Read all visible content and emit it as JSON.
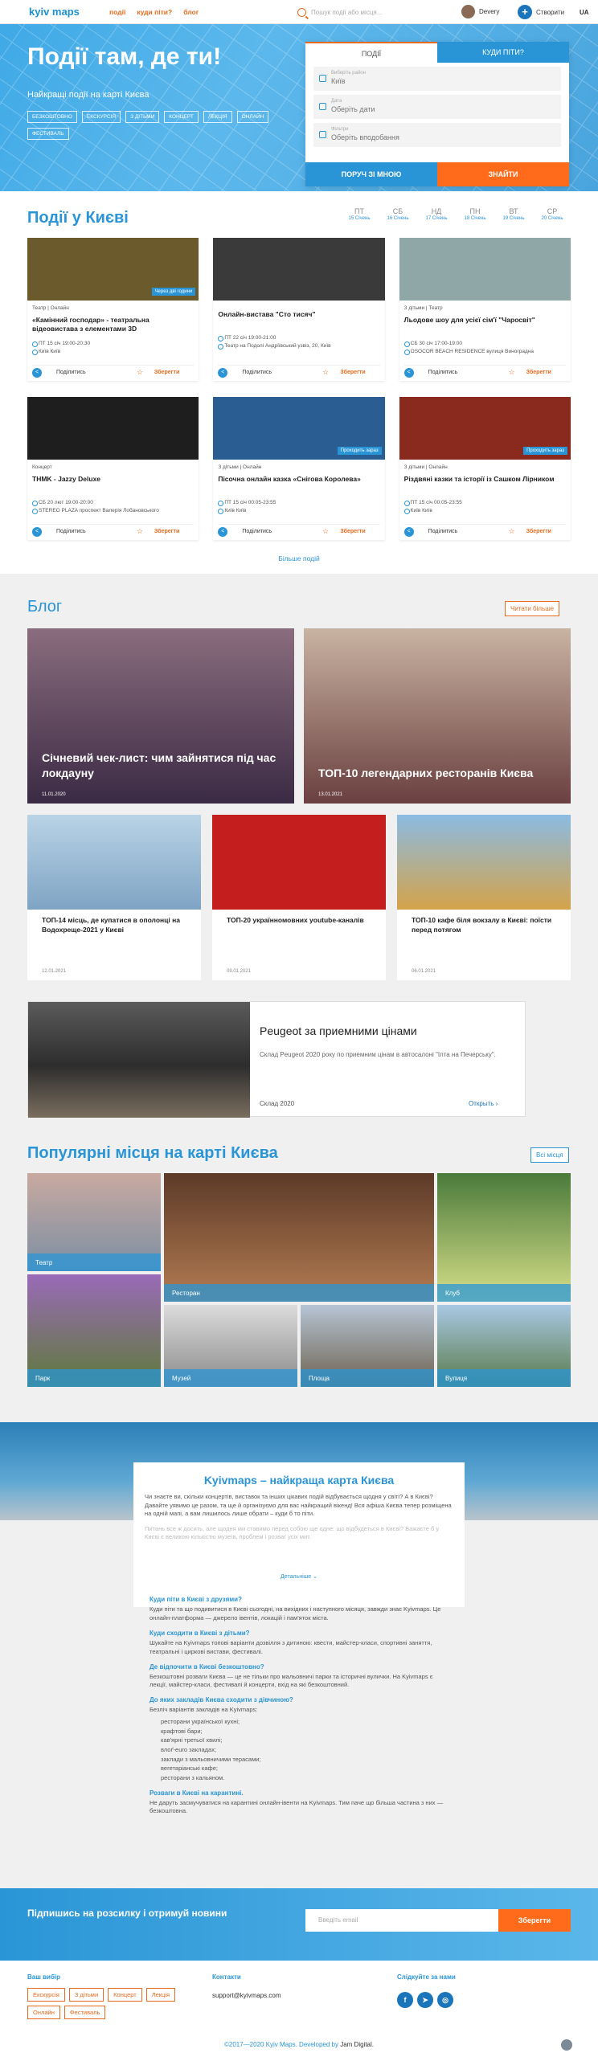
{
  "header": {
    "logo": "kyiv maps",
    "nav": [
      "події",
      "куди піти?",
      "блог"
    ],
    "search_placeholder": "Пошук події або місця...",
    "user_name": "Devery",
    "create_label": "Створити",
    "language": "UA"
  },
  "hero": {
    "title": "Події там, де ти!",
    "subtitle": "Найкращі події на карті Києва",
    "tags": [
      "безкоштовно",
      "екскурсія",
      "з дітьми",
      "концерт",
      "лекція",
      "онлайн",
      "фестиваль"
    ]
  },
  "search_box": {
    "tabs": [
      "ПОДІЇ",
      "КУДИ ПІТИ?"
    ],
    "fields": [
      {
        "label": "Виберіть район",
        "value": "Київ"
      },
      {
        "label": "Дата",
        "value": "Оберіть дати"
      },
      {
        "label": "Фільтри",
        "value": "Оберіть вподобання"
      }
    ],
    "nearby_button": "ПОРУЧ ЗІ МНОЮ",
    "find_button": "ЗНАЙТИ"
  },
  "events": {
    "title": "Події у Києві",
    "days": [
      {
        "name": "ПТ",
        "date": "15 Січень"
      },
      {
        "name": "СБ",
        "date": "16 Січень"
      },
      {
        "name": "НД",
        "date": "17 Січень"
      },
      {
        "name": "ПН",
        "date": "18 Січень"
      },
      {
        "name": "ВТ",
        "date": "19 Січень"
      },
      {
        "name": "СР",
        "date": "20 Січень"
      }
    ],
    "cards": [
      {
        "category": "Театр | Онлайн",
        "title": "«Камінний господар» - театральна відеовистава з елементами 3D",
        "date": "ПТ 15 січ 19:00-20:30",
        "place": "Київ Київ",
        "badge": "Через дві години",
        "color": "#6b5a2c"
      },
      {
        "category": "",
        "title": "Онлайн-вистава \"Сто тисяч\"",
        "date": "ПТ 22 січ 19:00-21:00",
        "place": "Театр на Подолі Андріївський узвіз, 20, Київ",
        "badge": "",
        "color": "#3a3a3a"
      },
      {
        "category": "З дітьми | Театр",
        "title": "Льодове шоу для усієї сім'ї \"Чаросвіт\"",
        "date": "СБ 30 січ 17:00-19:00",
        "place": "OSOCOR BEACH RESIDENCE вулиця Виноградна",
        "badge": "",
        "color": "#8fa7a6"
      },
      {
        "category": "Концерт",
        "title": "THMK - Jazzy Deluxe",
        "date": "СБ 20 лют 19:00-20:00",
        "place": "STEREO PLAZA проспект Валерія Лобановського",
        "badge": "",
        "color": "#1e1e1e"
      },
      {
        "category": "З дітьми | Онлайн",
        "title": "Пісочна онлайн казка «Снігова Королева»",
        "date": "ПТ 15 січ 00:05-23:55",
        "place": "Київ Київ",
        "badge": "Проходить зараз",
        "color": "#2a5e93"
      },
      {
        "category": "З дітьми | Онлайн",
        "title": "Різдвяні казки та історії із Сашком Лірником",
        "date": "ПТ 15 січ 00:05-23:55",
        "place": "Київ Київ",
        "badge": "Проходить зараз",
        "color": "#8a2a1e"
      }
    ],
    "share_label": "Поділитись",
    "save_label": "Зберегти",
    "more_label": "Більше подій"
  },
  "blog": {
    "title": "Блог",
    "read_more": "Читати більше",
    "posts": [
      {
        "title": "Січневий чек-лист: чим зайнятися під час локдауну",
        "date": "11.01.2020",
        "color": "#5c4a63"
      },
      {
        "title": "ТОП-10 легендарних ресторанів Києва",
        "date": "13.01.2021",
        "color": "#7a5a5a"
      },
      {
        "title": "ТОП-14 місць, де купатися в ополонці на Водохреще-2021 у Києві",
        "date": "12.01.2021",
        "color": "#7fa4c4"
      },
      {
        "title": "ТОП-20 українномовних youtube-каналів",
        "date": "09.01.2021",
        "color": "#c41e1e"
      },
      {
        "title": "ТОП-10 кафе біля вокзалу в Києві: поїсти перед потягом",
        "date": "06.01.2021",
        "color": "#6aa0cc"
      }
    ]
  },
  "ad": {
    "title": "Peugeot за приемними цінами",
    "text": "Склад Peugeot 2020 року по приемним цінам в автосалоні \"Ілта на Печерську\".",
    "source": "Склад 2020",
    "open": "Открыть"
  },
  "popular": {
    "title": "Популярні місця на карті Києва",
    "all": "Всі місця",
    "places": [
      "Театр",
      "Ресторан",
      "Клуб",
      "Парк",
      "Музей",
      "Площа",
      "Вулиця"
    ]
  },
  "about": {
    "title": "Kyivmaps – найкраща карта Києва",
    "intro": "Чи знаєте ви, скільки концертів, виставок та інших цікавих подій відбувається щодня у світі? А в Києві? Давайте уявимо це разом, та ще й організуємо для вас найкращий вікенд! Вся афіша Києва тепер розміщена на одній мапі, а вам лишилось лише обрати – куди б то піти.",
    "faded": "Питань все ж досить, але щодня ми ставимо перед собою ще одне: що відбудеться в Києві? Бажаєте б у Києві є великою кількістю музеїв, проблем і розваг усіх мит.",
    "details": "Детальніше",
    "faq": [
      {
        "q": "Куди піти в Києві з друзями?",
        "a": "Куди піти та що подивитися в Києві сьогодні, на вихідних і наступного місяця, завжди знає Kyivmaps. Це онлайн-платформа — джерело івентів, локацій і пам'яток міста."
      },
      {
        "q": "Куди сходити в Києві з дітьми?",
        "a": "Шукайте на Kyivmaps топові варіанти дозвілля з дитиною: квести, майстер-класи, спортивні заняття, театральні і циркові вистави, фестивалі."
      },
      {
        "q": "Де відпочити в Києві безкоштовно?",
        "a": "Безкоштовні розваги Києва — це не тільки про мальовничі парки та історичні вулички. На Kyivmaps є лекції, майстер-класи, фестивалі й концерти, вхід на які безкоштовний."
      },
      {
        "q": "До яких закладів Києва сходити з дівчиною?",
        "a": "Безліч варіантів закладів на Kyivmaps:"
      }
    ],
    "list": [
      "ресторани української кухні;",
      "крафтові бари;",
      "кав'ярні третьої хвилі;",
      "влоґ-euro закладах;",
      "заклади з мальовничими терасами;",
      "вегетаріанські кафе;",
      "ресторани з кальяном."
    ],
    "last_q": "Розваги в Києві на карантині.",
    "last_a": "Не даруть засмучуватися на карантині онлайн-івенти на Kyivmaps. Тим паче що більша частина з них — безкоштовна."
  },
  "newsletter": {
    "title": "Підпишись на розсилку і отримуй новини",
    "placeholder": "Введіть email",
    "button": "Зберегти"
  },
  "footer": {
    "choice_title": "Ваш вибір",
    "chips": [
      "Екскурсія",
      "З дітьми",
      "Концерт",
      "Лекція",
      "Онлайн",
      "Фестиваль"
    ],
    "contacts_title": "Контакти",
    "email": "support@kyivmaps.com",
    "follow_title": "Слідкуйте за нами",
    "copyright": "©2017—2020 Kyiv Maps. Developed by",
    "developer": "Jam Digital."
  }
}
